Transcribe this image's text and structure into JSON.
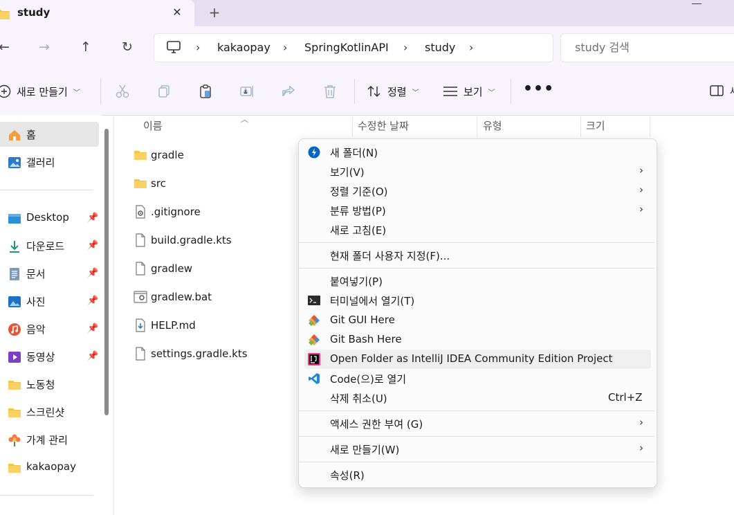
{
  "tab": {
    "title": "study",
    "close_glyph": "✕",
    "new_glyph": "+"
  },
  "nav": {
    "back": "←",
    "forward": "→",
    "up": "↑",
    "refresh": "↻",
    "sep": "›"
  },
  "breadcrumb": [
    "kakaopay",
    "SpringKotlinAPI",
    "study"
  ],
  "search": {
    "placeholder": "study 검색"
  },
  "commands": {
    "new_label": "새로 만들기",
    "sort_label": "정렬",
    "view_label": "보기",
    "more": "•••",
    "details_label": "세"
  },
  "sidebar": {
    "items": [
      {
        "label": "홈",
        "icon": "home-icon"
      },
      {
        "label": "갤러리",
        "icon": "gallery-icon"
      },
      {
        "label": "Desktop",
        "icon": "desktop-icon",
        "pinned": true
      },
      {
        "label": "다운로드",
        "icon": "download-icon",
        "pinned": true
      },
      {
        "label": "문서",
        "icon": "document-icon",
        "pinned": true
      },
      {
        "label": "사진",
        "icon": "pictures-icon",
        "pinned": true
      },
      {
        "label": "음악",
        "icon": "music-icon",
        "pinned": true
      },
      {
        "label": "동영상",
        "icon": "video-icon",
        "pinned": true
      },
      {
        "label": "노동청",
        "icon": "folder-icon"
      },
      {
        "label": "스크린샷",
        "icon": "folder-icon"
      },
      {
        "label": "가계 관리",
        "icon": "flower-icon"
      },
      {
        "label": "kakaopay",
        "icon": "folder-icon"
      }
    ],
    "pin_glyph": "📌"
  },
  "columns": {
    "name": "이름",
    "modified": "수정한 날짜",
    "type": "유형",
    "size": "크기"
  },
  "files": [
    {
      "name": "gradle",
      "icon": "folder-icon"
    },
    {
      "name": "src",
      "icon": "folder-icon"
    },
    {
      "name": ".gitignore",
      "icon": "settings-file-icon"
    },
    {
      "name": "build.gradle.kts",
      "icon": "file-icon"
    },
    {
      "name": "gradlew",
      "icon": "file-icon"
    },
    {
      "name": "gradlew.bat",
      "icon": "batch-file-icon"
    },
    {
      "name": "HELP.md",
      "icon": "markdown-file-icon"
    },
    {
      "name": "settings.gradle.kts",
      "icon": "file-icon"
    }
  ],
  "context_menu": {
    "items": [
      {
        "label": "새 폴더(N)",
        "icon": "new-folder-icon"
      },
      {
        "label": "보기(V)",
        "submenu": true
      },
      {
        "label": "정렬 기준(O)",
        "submenu": true
      },
      {
        "label": "분류 방법(P)",
        "submenu": true
      },
      {
        "label": "새로 고침(E)"
      },
      {
        "label": "현재 폴더 사용자 지정(F)..."
      },
      {
        "label": "붙여넣기(P)"
      },
      {
        "label": "터미널에서 열기(T)",
        "icon": "terminal-icon"
      },
      {
        "label": "Git GUI Here",
        "icon": "git-icon"
      },
      {
        "label": "Git Bash Here",
        "icon": "git-icon"
      },
      {
        "label": "Open Folder as IntelliJ IDEA Community Edition Project",
        "icon": "intellij-icon"
      },
      {
        "label": "Code(으)로 열기",
        "icon": "vscode-icon"
      },
      {
        "label": "삭제 취소(U)",
        "shortcut": "Ctrl+Z"
      },
      {
        "label": "액세스 권한 부여 (G)",
        "submenu": true
      },
      {
        "label": "새로 만들기(W)",
        "submenu": true
      },
      {
        "label": "속성(R)"
      }
    ],
    "arrow_glyph": "›"
  },
  "colors": {
    "titlebar": "#e5dff0",
    "chrome": "#f7f4fb",
    "folder": "#f6c445",
    "accent": "#0067c0"
  }
}
